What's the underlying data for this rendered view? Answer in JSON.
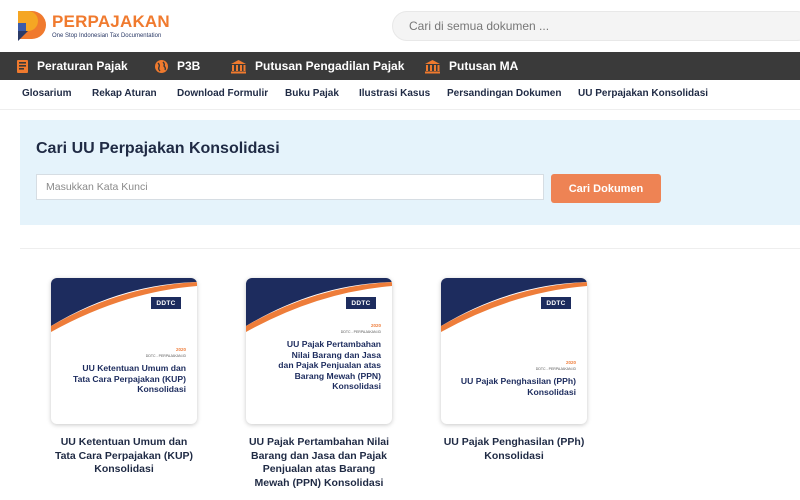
{
  "header": {
    "logo_text": "PERPAJAKAN",
    "logo_tagline": "One Stop Indonesian Tax Documentation",
    "search_placeholder": "Cari di semua dokumen ..."
  },
  "main_nav": [
    {
      "label": "Peraturan Pajak",
      "icon": "book-icon"
    },
    {
      "label": "P3B",
      "icon": "globe-icon"
    },
    {
      "label": "Putusan Pengadilan Pajak",
      "icon": "courthouse-icon"
    },
    {
      "label": "Putusan MA",
      "icon": "courthouse-icon"
    }
  ],
  "sub_nav": [
    {
      "label": "Glosarium",
      "dot": true
    },
    {
      "label": "Rekap Aturan",
      "dot": false
    },
    {
      "label": "Download Formulir",
      "dot": true
    },
    {
      "label": "Buku Pajak",
      "dot": true
    },
    {
      "label": "Ilustrasi Kasus",
      "dot": false
    },
    {
      "label": "Persandingan Dokumen",
      "dot": true
    },
    {
      "label": "UU Perpajakan Konsolidasi",
      "dot": true
    }
  ],
  "search_panel": {
    "title": "Cari UU Perpajakan Konsolidasi",
    "keyword_placeholder": "Masukkan Kata Kunci",
    "button_label": "Cari Dokumen"
  },
  "cards": [
    {
      "badge": "DDTC",
      "year": "2020",
      "org": "DDTC - PERPAJAKAN.ID",
      "cover_lines": [
        "UU Ketentuan Umum dan",
        "Tata Cara Perpajakan (KUP)",
        "Konsolidasi"
      ],
      "caption_lines": [
        "UU Ketentuan Umum dan",
        "Tata Cara Perpajakan (KUP)",
        "Konsolidasi"
      ]
    },
    {
      "badge": "DDTC",
      "year": "2020",
      "org": "DDTC - PERPAJAKAN.ID",
      "cover_lines": [
        "UU Pajak Pertambahan",
        "Nilai Barang dan Jasa",
        "dan Pajak Penjualan atas",
        "Barang Mewah (PPN)",
        "Konsolidasi"
      ],
      "caption_lines": [
        "UU Pajak Pertambahan Nilai",
        "Barang dan Jasa dan Pajak",
        "Penjualan atas Barang",
        "Mewah (PPN) Konsolidasi"
      ]
    },
    {
      "badge": "DDTC",
      "year": "2020",
      "org": "DDTC - PERPAJAKAN.ID",
      "cover_lines": [
        "UU Pajak Penghasilan (PPh)",
        "Konsolidasi"
      ],
      "caption_lines": [
        "UU Pajak Penghasilan (PPh)",
        "Konsolidasi"
      ]
    }
  ],
  "colors": {
    "brand_orange": "#f07a2e",
    "navy": "#1d2c5e",
    "nav_bg": "#3a3a3a",
    "panel_bg": "#e5f3fb",
    "button_bg": "#ee8354",
    "dot_red": "#e01e2b"
  }
}
